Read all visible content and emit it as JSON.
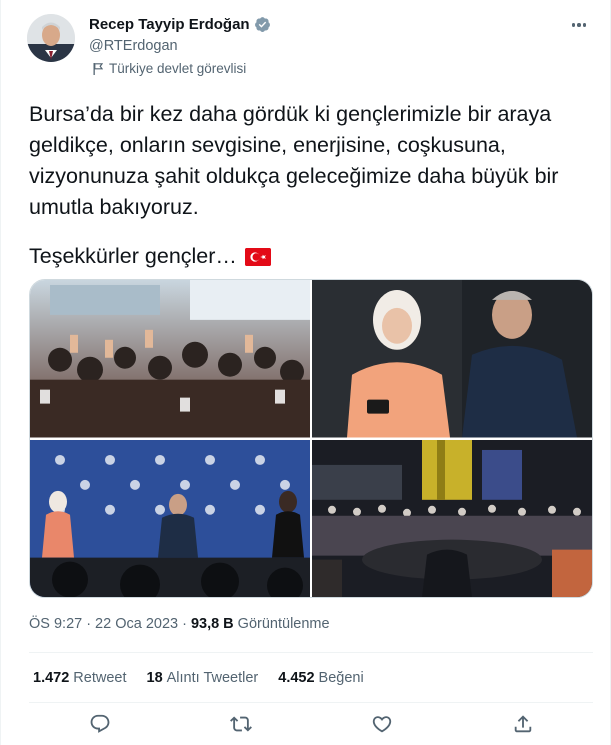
{
  "author": {
    "name": "Recep Tayyip Erdoğan",
    "handle": "@RTErdogan",
    "label": "Türkiye devlet görevlisi"
  },
  "tweet": {
    "text": "Bursa’da bir kez daha gördük ki gençlerimizle bir araya\ngeldikçe, onların sevgisine, enerjisine, coşkusuna,\nvizyonunuza şahit oldukça geleceğimize daha büyük bir\numutla bakıyoruz.",
    "thanks": "Teşekkürler gençler…"
  },
  "meta": {
    "time": "ÖS 9:27",
    "separator": "·",
    "date": "22 Oca 2023",
    "views_count": "93,8 B",
    "views_label": "Görüntülenme"
  },
  "stats": {
    "retweets_count": "1.472",
    "retweets_label": "Retweet",
    "quotes_count": "18",
    "quotes_label": "Alıntı Tweetler",
    "likes_count": "4.452",
    "likes_label": "Beğeni"
  },
  "colors": {
    "text": "#0f1419",
    "secondary": "#536471",
    "verified": "#829aab",
    "flag_red": "#e30a17",
    "border": "#eff3f4"
  },
  "icons": {
    "more": "more-horizontal-icon",
    "verified": "verified-badge-icon",
    "label": "flag-icon",
    "reply": "reply-icon",
    "retweet": "retweet-icon",
    "like": "heart-icon",
    "share": "share-icon"
  }
}
